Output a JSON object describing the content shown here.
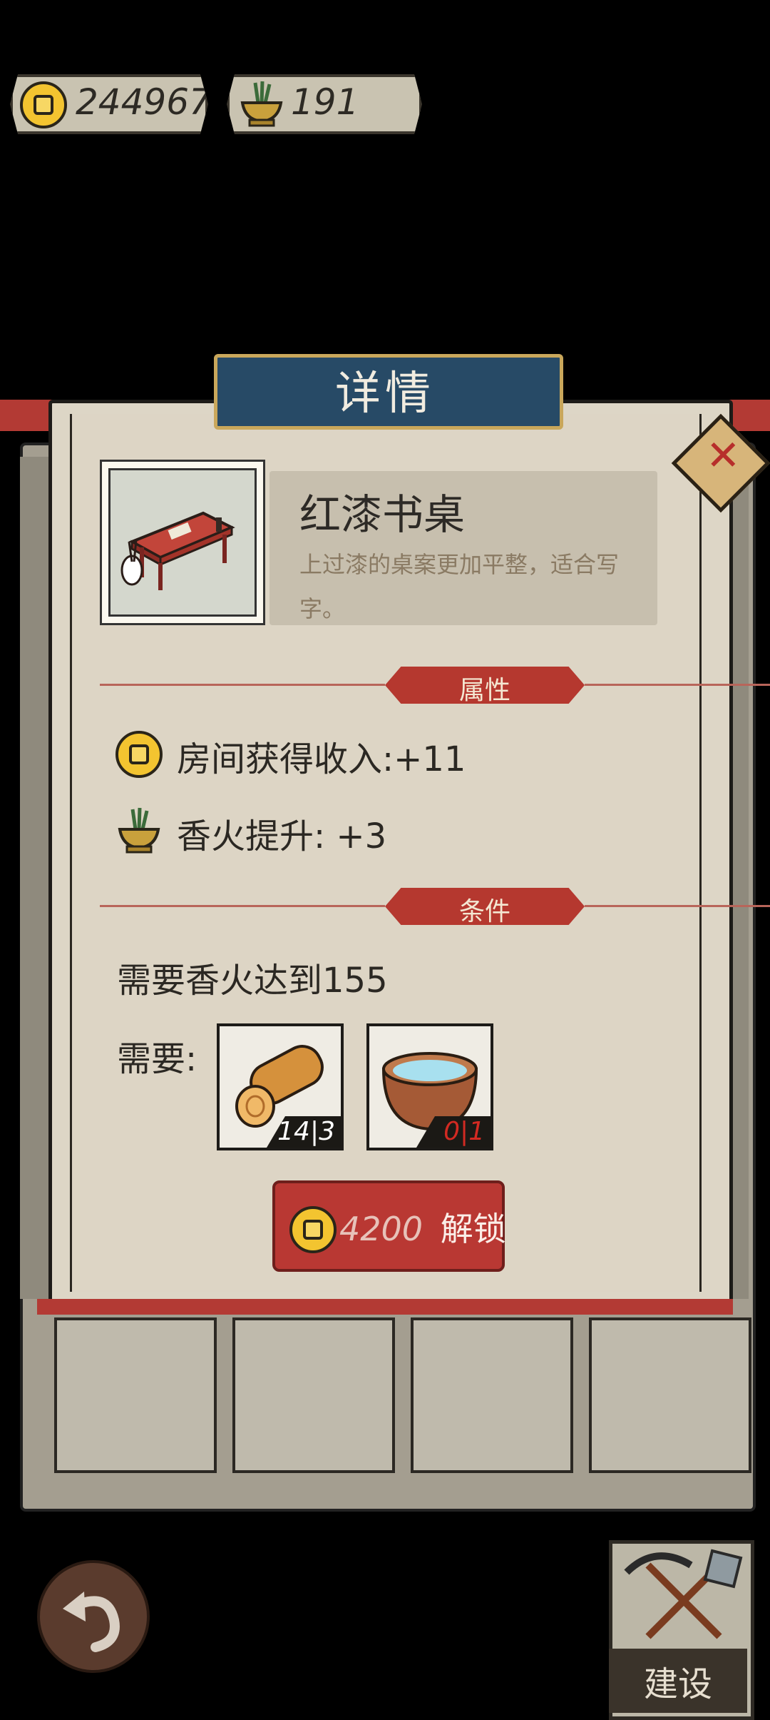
{
  "resources": {
    "coins": "244967",
    "incense": "191"
  },
  "dialog": {
    "title": "详情",
    "close_icon": "close-x-icon"
  },
  "item": {
    "name": "红漆书桌",
    "description": "上过漆的桌案更加平整，适合写字。"
  },
  "attributes": {
    "header": "属性",
    "income": "房间获得收入:+11",
    "incense_boost": "香火提升:  +3"
  },
  "conditions": {
    "header": "条件",
    "requirement": "需要香火达到155",
    "needs_label": "需要:",
    "materials": [
      {
        "icon": "wood-log-icon",
        "count": "14|3",
        "count_color": "#ffffff"
      },
      {
        "icon": "water-bowl-icon",
        "count": "0|1",
        "count_color": "#d22a22"
      }
    ]
  },
  "unlock": {
    "price": "4200",
    "label": "解锁"
  },
  "bottom": {
    "build_label": "建设"
  },
  "colors": {
    "accent_red": "#b5382f",
    "banner_blue": "#274a66",
    "parchment": "#ddd6c6"
  }
}
